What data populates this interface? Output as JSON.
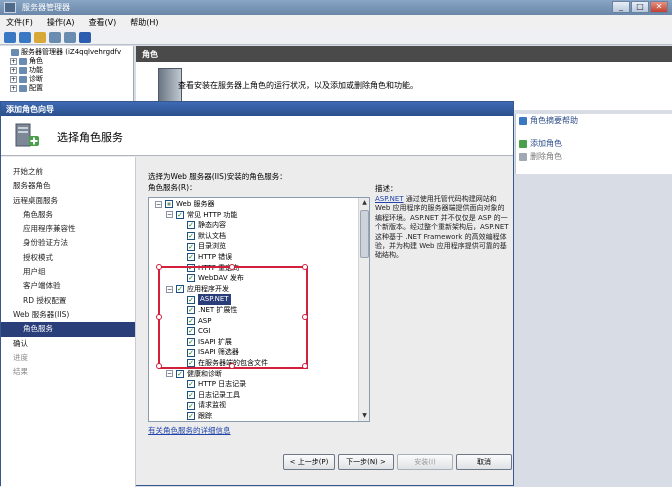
{
  "window": {
    "title": "服务器管理器",
    "min": "_",
    "max": "□",
    "close": "✕"
  },
  "menu": [
    "文件(F)",
    "操作(A)",
    "查看(V)",
    "帮助(H)"
  ],
  "tree": [
    {
      "label": "服务器管理器 (iZ4qqlvehrgdfv",
      "toggle": "",
      "level": 0
    },
    {
      "label": "角色",
      "toggle": "+",
      "level": 1
    },
    {
      "label": "功能",
      "toggle": "+",
      "level": 1
    },
    {
      "label": "诊断",
      "toggle": "+",
      "level": 1
    },
    {
      "label": "配置",
      "toggle": "+",
      "level": 1
    }
  ],
  "content": {
    "header": "角色",
    "text": "查看安装在服务器上角色的运行状况，以及添加或删除角色和功能。"
  },
  "actions": {
    "help": "角色摘要帮助",
    "add": "添加角色",
    "remove": "删除角色"
  },
  "wizard": {
    "title": "添加角色向导",
    "heading": "选择角色服务",
    "instruction": "选择为Web 服务器(IIS)安装的角色服务：",
    "services_label": "角色服务(R)：",
    "description_label": "描述：",
    "description_link": "ASP.NET",
    "description_text": " 通过使用托管代码构建网站和 Web 应用程序的服务器端提供面向对象的编程环境。ASP.NET 并不仅仅是 ASP 的一个新版本。经过整个重新架构后，ASP.NET 这种基于 .NET Framework 的高效编程体验，并为构建 Web 应用程序提供可靠的基础结构。",
    "more_link": "有关角色服务的详细信息",
    "nav": [
      {
        "label": "开始之前",
        "sub": false,
        "state": "normal"
      },
      {
        "label": "服务器角色",
        "sub": false,
        "state": "normal"
      },
      {
        "label": "远程桌面服务",
        "sub": false,
        "state": "normal"
      },
      {
        "label": "角色服务",
        "sub": true,
        "state": "normal"
      },
      {
        "label": "应用程序兼容性",
        "sub": true,
        "state": "normal"
      },
      {
        "label": "身份验证方法",
        "sub": true,
        "state": "normal"
      },
      {
        "label": "授权模式",
        "sub": true,
        "state": "normal"
      },
      {
        "label": "用户组",
        "sub": true,
        "state": "normal"
      },
      {
        "label": "客户端体验",
        "sub": true,
        "state": "normal"
      },
      {
        "label": "RD 授权配置",
        "sub": true,
        "state": "normal"
      },
      {
        "label": "Web 服务器(IIS)",
        "sub": false,
        "state": "normal"
      },
      {
        "label": "角色服务",
        "sub": true,
        "state": "active"
      },
      {
        "label": "确认",
        "sub": false,
        "state": "normal"
      },
      {
        "label": "进度",
        "sub": false,
        "state": "disabled"
      },
      {
        "label": "结果",
        "sub": false,
        "state": "disabled"
      }
    ],
    "services": [
      {
        "label": "Web 服务器",
        "level": 0,
        "exp": "−",
        "check": "partial"
      },
      {
        "label": "常见 HTTP 功能",
        "level": 1,
        "exp": "−",
        "check": "checked"
      },
      {
        "label": "静态内容",
        "level": 2,
        "exp": "",
        "check": "checked"
      },
      {
        "label": "默认文档",
        "level": 2,
        "exp": "",
        "check": "checked"
      },
      {
        "label": "目录浏览",
        "level": 2,
        "exp": "",
        "check": "checked"
      },
      {
        "label": "HTTP 错误",
        "level": 2,
        "exp": "",
        "check": "checked"
      },
      {
        "label": "HTTP 重定向",
        "level": 2,
        "exp": "",
        "check": "checked"
      },
      {
        "label": "WebDAV 发布",
        "level": 2,
        "exp": "",
        "check": "checked"
      },
      {
        "label": "应用程序开发",
        "level": 1,
        "exp": "−",
        "check": "checked"
      },
      {
        "label": "ASP.NET",
        "level": 2,
        "exp": "",
        "check": "checked",
        "selected": true
      },
      {
        "label": ".NET 扩展性",
        "level": 2,
        "exp": "",
        "check": "checked"
      },
      {
        "label": "ASP",
        "level": 2,
        "exp": "",
        "check": "checked"
      },
      {
        "label": "CGI",
        "level": 2,
        "exp": "",
        "check": "checked"
      },
      {
        "label": "ISAPI 扩展",
        "level": 2,
        "exp": "",
        "check": "checked"
      },
      {
        "label": "ISAPI 筛选器",
        "level": 2,
        "exp": "",
        "check": "checked"
      },
      {
        "label": "在服务器端的包含文件",
        "level": 2,
        "exp": "",
        "check": "checked"
      },
      {
        "label": "健康和诊断",
        "level": 1,
        "exp": "−",
        "check": "checked"
      },
      {
        "label": "HTTP 日志记录",
        "level": 2,
        "exp": "",
        "check": "checked"
      },
      {
        "label": "日志记录工具",
        "level": 2,
        "exp": "",
        "check": "checked"
      },
      {
        "label": "请求监视",
        "level": 2,
        "exp": "",
        "check": "checked"
      },
      {
        "label": "跟踪",
        "level": 2,
        "exp": "",
        "check": "checked"
      }
    ],
    "buttons": {
      "prev": "< 上一步(P)",
      "next": "下一步(N) >",
      "install": "安装(I)",
      "cancel": "取消"
    }
  },
  "colors": {
    "title_bar": "#2a4f8c",
    "selection": "#2a3e7a",
    "annotation": "#d21f3c"
  }
}
